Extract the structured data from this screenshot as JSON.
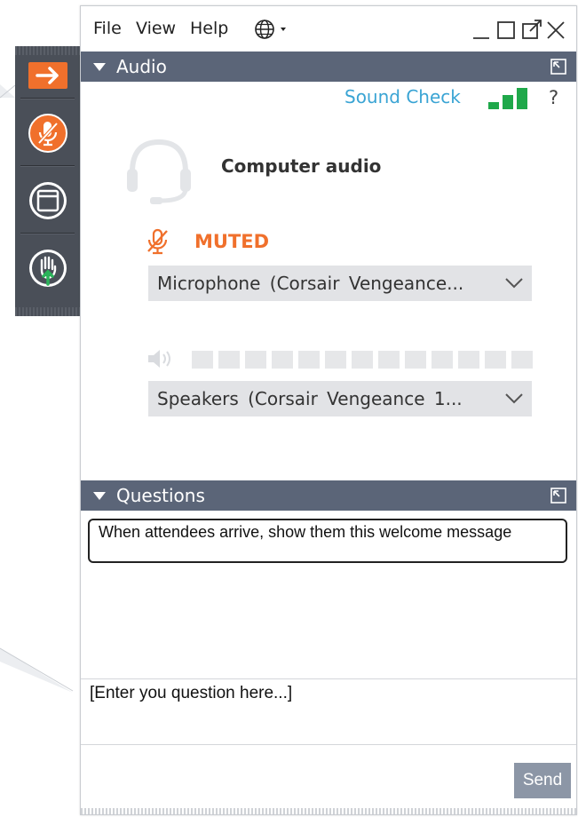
{
  "menubar": {
    "file": "File",
    "view": "View",
    "help": "Help"
  },
  "audio": {
    "section_title": "Audio",
    "sound_check": "Sound Check",
    "help_symbol": "?",
    "mode_label": "Computer audio",
    "mute_status": "MUTED",
    "microphone": {
      "selected": "Microphone  (Corsair  Vengeance..."
    },
    "speakers": {
      "selected": "Speakers  (Corsair  Vengeance 1..."
    },
    "speaker_level_segments": 13
  },
  "questions": {
    "section_title": "Questions",
    "welcome_message": "When attendees arrive, show them this welcome message",
    "input_value": "[Enter you question here...]",
    "send_label": "Send"
  },
  "colors": {
    "accent_orange": "#f0702c",
    "link_blue": "#3aa4d4",
    "signal_green": "#1fa84a",
    "section_bar": "#5b6578"
  },
  "icons": {
    "toolbar": [
      "arrow-right-icon",
      "muted-mic-icon",
      "window-icon",
      "raise-hand-icon"
    ]
  }
}
